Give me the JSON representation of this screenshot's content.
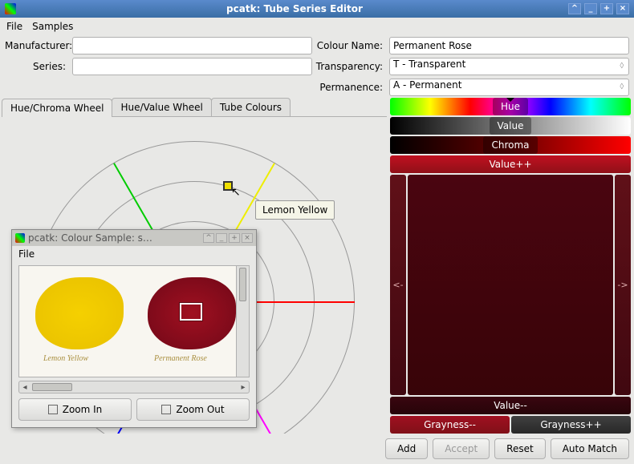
{
  "window": {
    "title": "pcatk: Tube Series Editor"
  },
  "menubar": {
    "file": "File",
    "samples": "Samples"
  },
  "fields": {
    "manufacturer_label": "Manufacturer:",
    "manufacturer_value": "",
    "series_label": "Series:",
    "series_value": "",
    "colour_name_label": "Colour Name:",
    "colour_name_value": "Permanent Rose",
    "transparency_label": "Transparency:",
    "transparency_value": "T    - Transparent",
    "permanence_label": "Permanence:",
    "permanence_value": "A    - Permanent"
  },
  "tabs": {
    "hue_chroma": "Hue/Chroma Wheel",
    "hue_value": "Hue/Value Wheel",
    "tube_colours": "Tube Colours"
  },
  "wheel": {
    "tooltip": "Lemon Yellow"
  },
  "subwindow": {
    "title": "pcatk: Colour Sample: s…",
    "menu_file": "File",
    "swatch1_label": "Lemon Yellow",
    "swatch2_label": "Permanent Rose",
    "zoom_in": "Zoom In",
    "zoom_out": "Zoom Out"
  },
  "editor": {
    "hue": "Hue",
    "value": "Value",
    "chroma": "Chroma",
    "value_pp": "Value++",
    "value_mm": "Value--",
    "left": "<-",
    "right": "->",
    "gray_mm": "Grayness--",
    "gray_pp": "Grayness++"
  },
  "buttons": {
    "add": "Add",
    "accept": "Accept",
    "reset": "Reset",
    "auto_match": "Auto Match"
  }
}
